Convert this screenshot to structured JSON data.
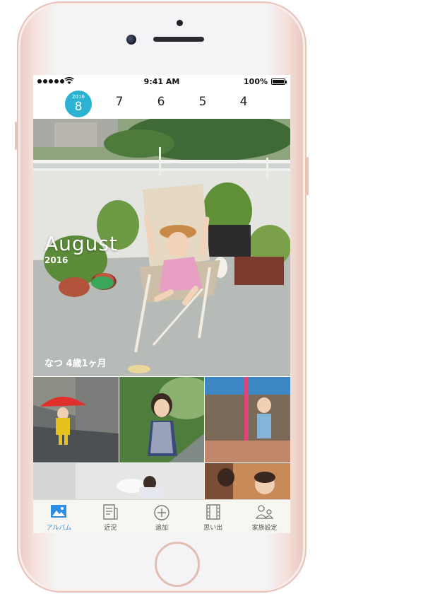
{
  "status_bar": {
    "time": "9:41 AM",
    "battery": "100%"
  },
  "month_selector": {
    "active": {
      "year": "2016",
      "month": "8"
    },
    "months": [
      "7",
      "6",
      "5",
      "4"
    ]
  },
  "hero": {
    "title": "August",
    "year": "2016",
    "caption": "なつ  4歳1ヶ月"
  },
  "colors": {
    "accent": "#2cb3d2",
    "tab_active": "#2a8fe0"
  },
  "tabs": [
    {
      "label": "アルバム",
      "icon": "album-icon",
      "active": true
    },
    {
      "label": "近況",
      "icon": "news-icon",
      "active": false
    },
    {
      "label": "追加",
      "icon": "add-icon",
      "active": false
    },
    {
      "label": "思い出",
      "icon": "film-icon",
      "active": false
    },
    {
      "label": "家族設定",
      "icon": "family-icon",
      "active": false
    }
  ]
}
